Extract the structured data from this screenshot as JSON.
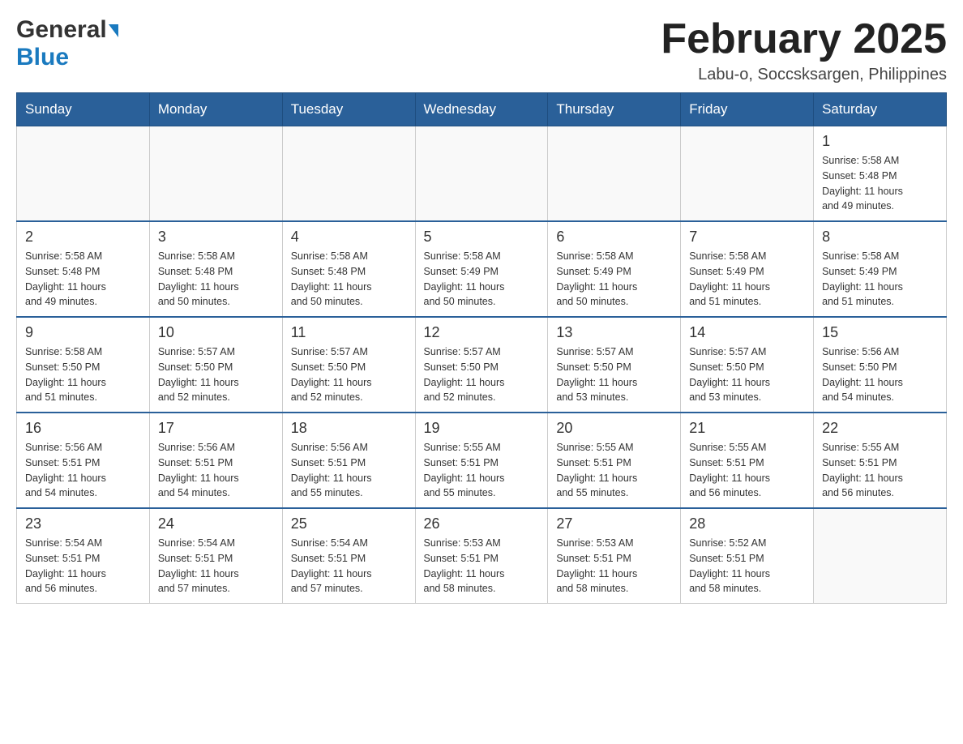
{
  "header": {
    "logo_general": "General",
    "logo_blue": "Blue",
    "month_title": "February 2025",
    "location": "Labu-o, Soccsksargen, Philippines"
  },
  "weekdays": [
    "Sunday",
    "Monday",
    "Tuesday",
    "Wednesday",
    "Thursday",
    "Friday",
    "Saturday"
  ],
  "weeks": [
    {
      "cells": [
        {
          "day": "",
          "info": ""
        },
        {
          "day": "",
          "info": ""
        },
        {
          "day": "",
          "info": ""
        },
        {
          "day": "",
          "info": ""
        },
        {
          "day": "",
          "info": ""
        },
        {
          "day": "",
          "info": ""
        },
        {
          "day": "1",
          "info": "Sunrise: 5:58 AM\nSunset: 5:48 PM\nDaylight: 11 hours\nand 49 minutes."
        }
      ]
    },
    {
      "cells": [
        {
          "day": "2",
          "info": "Sunrise: 5:58 AM\nSunset: 5:48 PM\nDaylight: 11 hours\nand 49 minutes."
        },
        {
          "day": "3",
          "info": "Sunrise: 5:58 AM\nSunset: 5:48 PM\nDaylight: 11 hours\nand 50 minutes."
        },
        {
          "day": "4",
          "info": "Sunrise: 5:58 AM\nSunset: 5:48 PM\nDaylight: 11 hours\nand 50 minutes."
        },
        {
          "day": "5",
          "info": "Sunrise: 5:58 AM\nSunset: 5:49 PM\nDaylight: 11 hours\nand 50 minutes."
        },
        {
          "day": "6",
          "info": "Sunrise: 5:58 AM\nSunset: 5:49 PM\nDaylight: 11 hours\nand 50 minutes."
        },
        {
          "day": "7",
          "info": "Sunrise: 5:58 AM\nSunset: 5:49 PM\nDaylight: 11 hours\nand 51 minutes."
        },
        {
          "day": "8",
          "info": "Sunrise: 5:58 AM\nSunset: 5:49 PM\nDaylight: 11 hours\nand 51 minutes."
        }
      ]
    },
    {
      "cells": [
        {
          "day": "9",
          "info": "Sunrise: 5:58 AM\nSunset: 5:50 PM\nDaylight: 11 hours\nand 51 minutes."
        },
        {
          "day": "10",
          "info": "Sunrise: 5:57 AM\nSunset: 5:50 PM\nDaylight: 11 hours\nand 52 minutes."
        },
        {
          "day": "11",
          "info": "Sunrise: 5:57 AM\nSunset: 5:50 PM\nDaylight: 11 hours\nand 52 minutes."
        },
        {
          "day": "12",
          "info": "Sunrise: 5:57 AM\nSunset: 5:50 PM\nDaylight: 11 hours\nand 52 minutes."
        },
        {
          "day": "13",
          "info": "Sunrise: 5:57 AM\nSunset: 5:50 PM\nDaylight: 11 hours\nand 53 minutes."
        },
        {
          "day": "14",
          "info": "Sunrise: 5:57 AM\nSunset: 5:50 PM\nDaylight: 11 hours\nand 53 minutes."
        },
        {
          "day": "15",
          "info": "Sunrise: 5:56 AM\nSunset: 5:50 PM\nDaylight: 11 hours\nand 54 minutes."
        }
      ]
    },
    {
      "cells": [
        {
          "day": "16",
          "info": "Sunrise: 5:56 AM\nSunset: 5:51 PM\nDaylight: 11 hours\nand 54 minutes."
        },
        {
          "day": "17",
          "info": "Sunrise: 5:56 AM\nSunset: 5:51 PM\nDaylight: 11 hours\nand 54 minutes."
        },
        {
          "day": "18",
          "info": "Sunrise: 5:56 AM\nSunset: 5:51 PM\nDaylight: 11 hours\nand 55 minutes."
        },
        {
          "day": "19",
          "info": "Sunrise: 5:55 AM\nSunset: 5:51 PM\nDaylight: 11 hours\nand 55 minutes."
        },
        {
          "day": "20",
          "info": "Sunrise: 5:55 AM\nSunset: 5:51 PM\nDaylight: 11 hours\nand 55 minutes."
        },
        {
          "day": "21",
          "info": "Sunrise: 5:55 AM\nSunset: 5:51 PM\nDaylight: 11 hours\nand 56 minutes."
        },
        {
          "day": "22",
          "info": "Sunrise: 5:55 AM\nSunset: 5:51 PM\nDaylight: 11 hours\nand 56 minutes."
        }
      ]
    },
    {
      "cells": [
        {
          "day": "23",
          "info": "Sunrise: 5:54 AM\nSunset: 5:51 PM\nDaylight: 11 hours\nand 56 minutes."
        },
        {
          "day": "24",
          "info": "Sunrise: 5:54 AM\nSunset: 5:51 PM\nDaylight: 11 hours\nand 57 minutes."
        },
        {
          "day": "25",
          "info": "Sunrise: 5:54 AM\nSunset: 5:51 PM\nDaylight: 11 hours\nand 57 minutes."
        },
        {
          "day": "26",
          "info": "Sunrise: 5:53 AM\nSunset: 5:51 PM\nDaylight: 11 hours\nand 58 minutes."
        },
        {
          "day": "27",
          "info": "Sunrise: 5:53 AM\nSunset: 5:51 PM\nDaylight: 11 hours\nand 58 minutes."
        },
        {
          "day": "28",
          "info": "Sunrise: 5:52 AM\nSunset: 5:51 PM\nDaylight: 11 hours\nand 58 minutes."
        },
        {
          "day": "",
          "info": ""
        }
      ]
    }
  ]
}
